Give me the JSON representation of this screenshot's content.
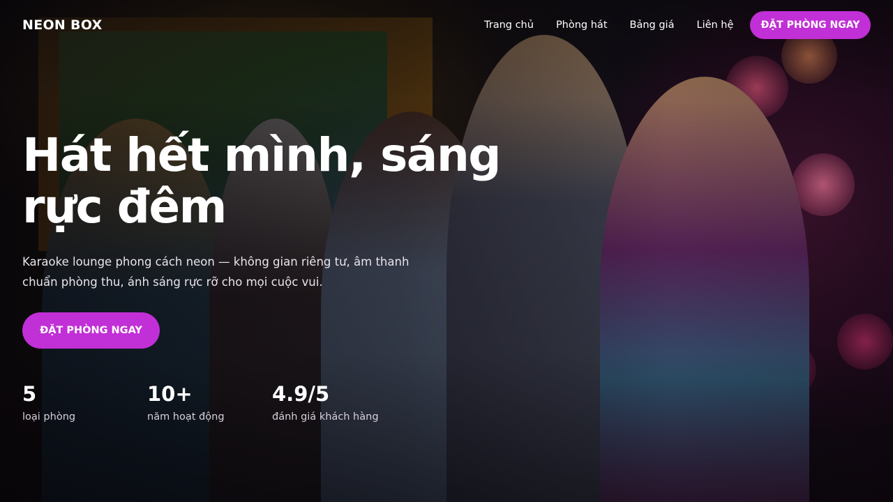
{
  "brand": {
    "logo_text": "NEON BOX"
  },
  "nav": {
    "items": [
      {
        "label": "Trang chủ"
      },
      {
        "label": "Phòng hát"
      },
      {
        "label": "Bảng giá"
      },
      {
        "label": "Liên hệ"
      }
    ],
    "cta_label": "ĐẶT PHÒNG NGAY"
  },
  "hero": {
    "headline_line1": "Hát hết mình, sáng",
    "headline_line2": "rực đêm",
    "subtitle_line1": "Karaoke lounge phong cách neon — không gian riêng tư, âm thanh",
    "subtitle_line2": "chuẩn phòng thu, ánh sáng rực rỡ cho mọi cuộc vui.",
    "cta_label": "ĐẶT PHÒNG NGAY"
  },
  "stats": [
    {
      "value": "5",
      "label": "loại phòng"
    },
    {
      "value": "10+",
      "label": "năm hoạt động"
    },
    {
      "value": "4.9/5",
      "label": "đánh giá khách hàng"
    }
  ],
  "colors": {
    "accent": "#c12fd6",
    "text": "#ffffff",
    "background": "#0b0710"
  }
}
